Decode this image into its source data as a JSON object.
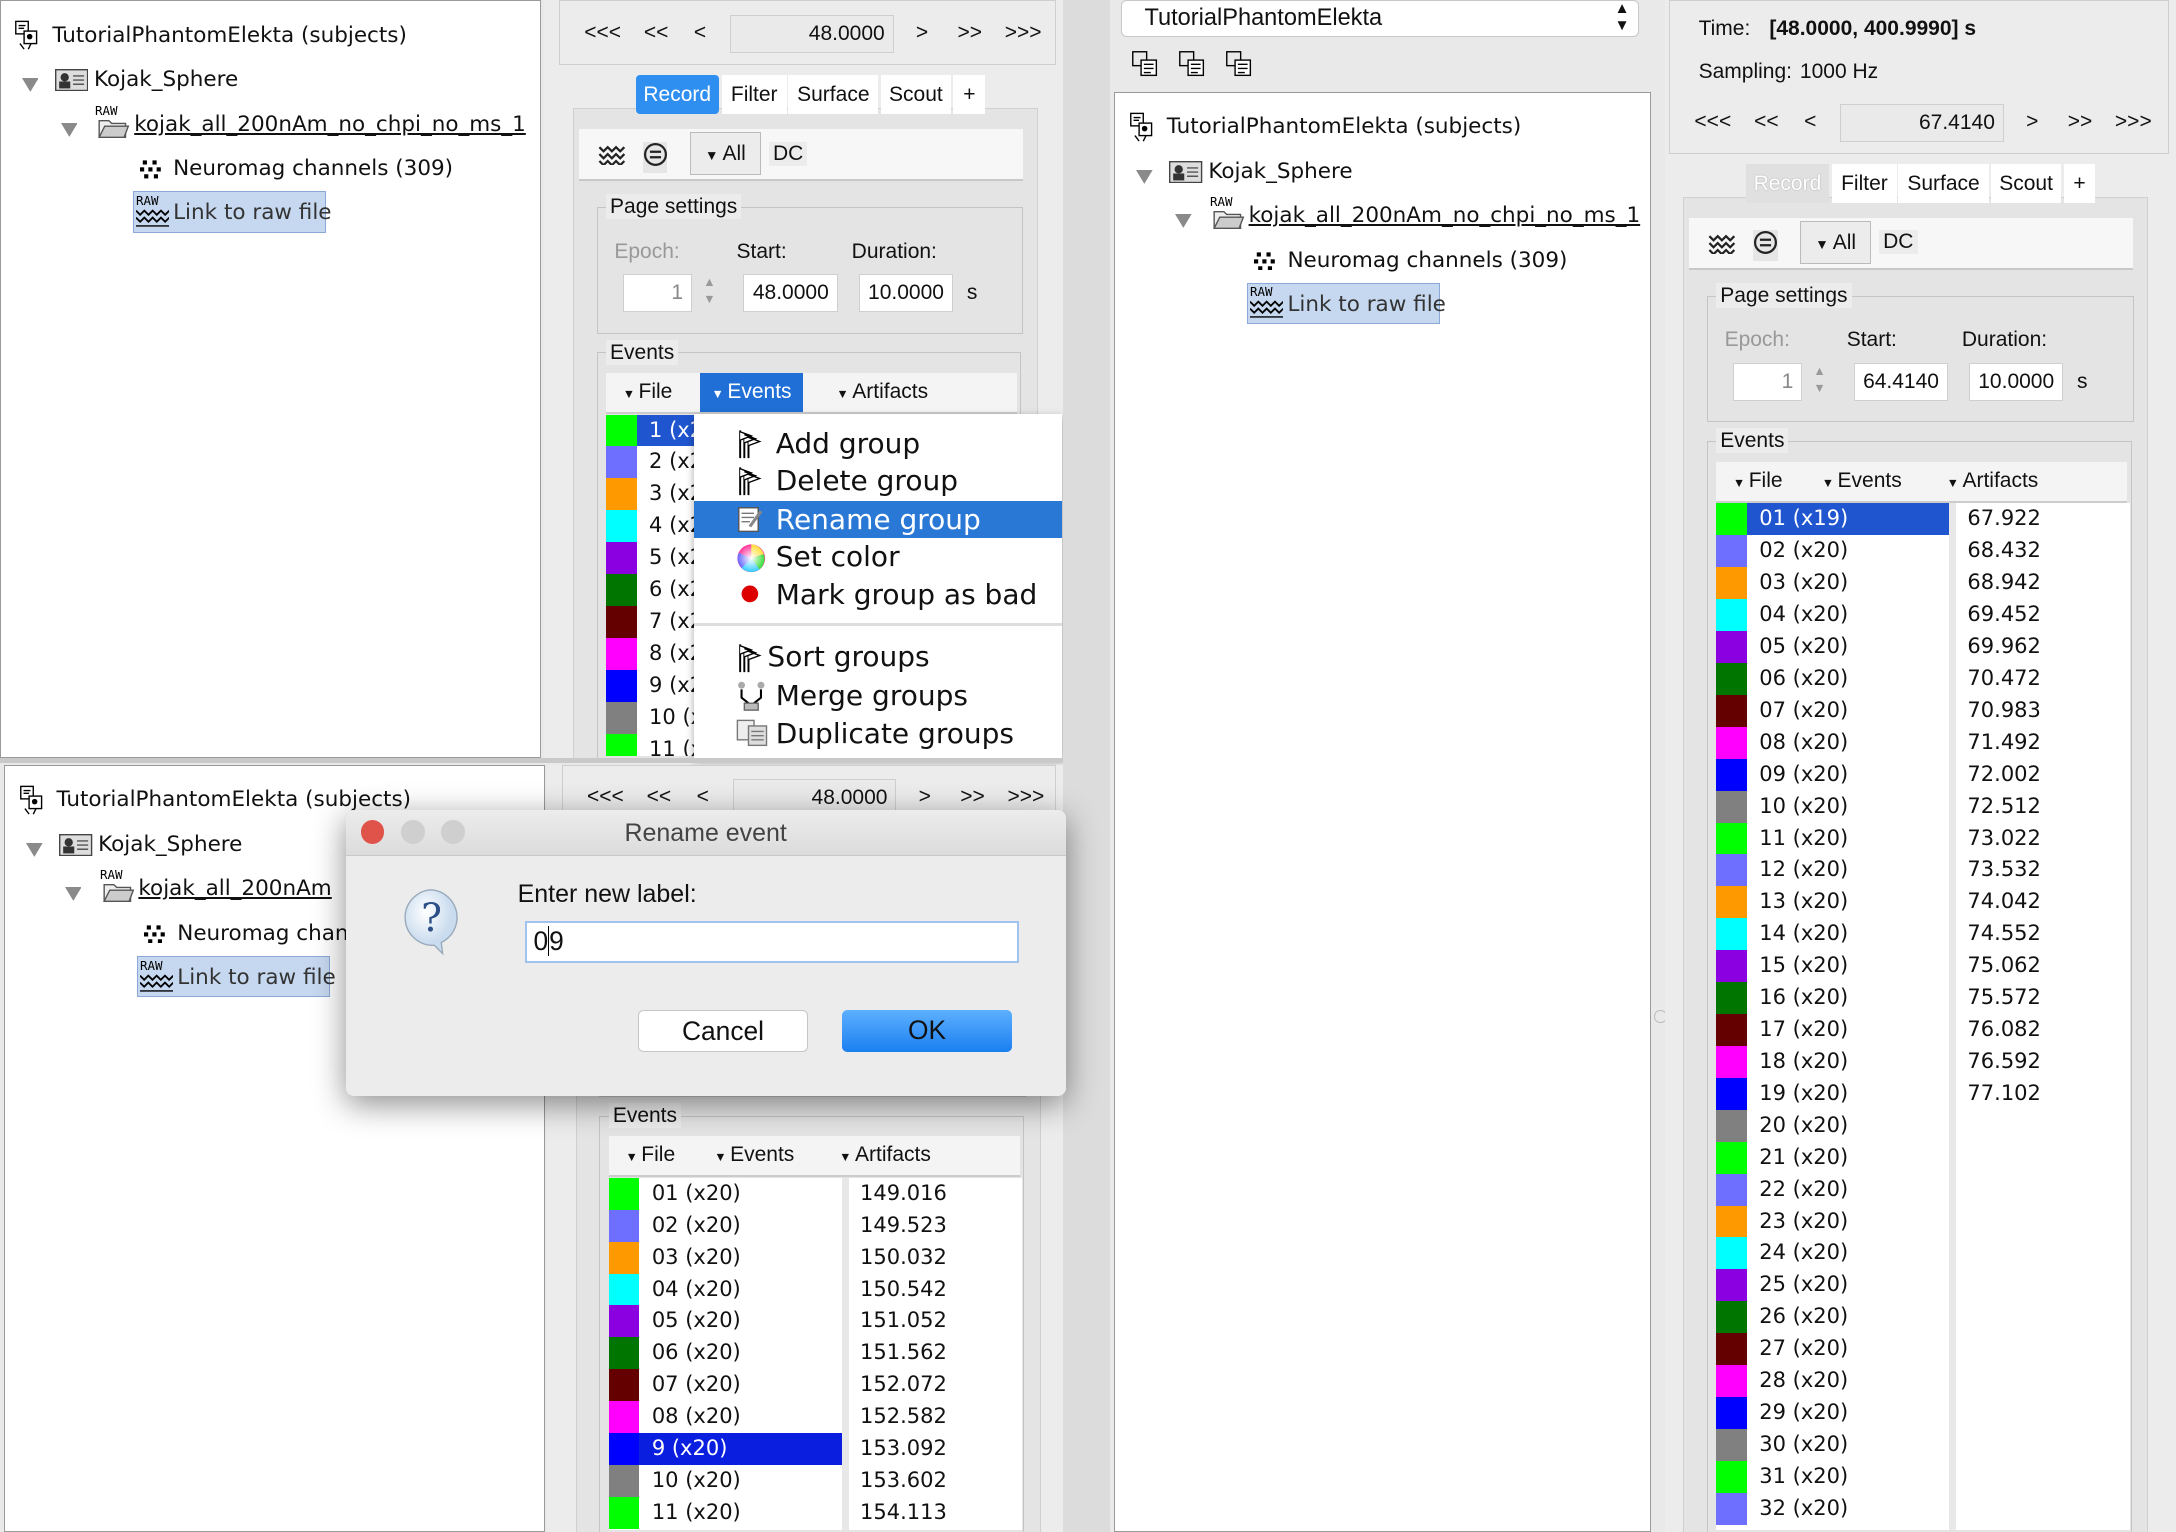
{
  "palette": [
    "#00ff00",
    "#6e6eff",
    "#ff9900",
    "#00ffff",
    "#8a00e0",
    "#007500",
    "#650000",
    "#ff00ff",
    "#0000ff",
    "#808080"
  ],
  "tree": {
    "root": "TutorialPhantomElekta (subjects)",
    "subject": "Kojak_Sphere",
    "file": "kojak_all_200nAm_no_chpi_no_ms_1",
    "file_short": "kojak_all_200nAm",
    "raw_badge": "RAW",
    "channels": "Neuromag channels (309)",
    "channels_short": "Neuromag chan",
    "link": "Link to raw file"
  },
  "nav": {
    "first": "<<<",
    "prev_big": "<<",
    "prev": "<",
    "next": ">",
    "next_big": ">>",
    "last": ">>>"
  },
  "tabs": [
    "Record",
    "Filter",
    "Surface",
    "Scout",
    "+"
  ],
  "toolbar": {
    "all": "All",
    "dc": "DC"
  },
  "page_settings": {
    "title": "Page settings",
    "epoch_label": "Epoch:",
    "start_label": "Start:",
    "duration_label": "Duration:",
    "unit": "s"
  },
  "events_box": {
    "title": "Events",
    "menus": [
      "File",
      "Events",
      "Artifacts"
    ]
  },
  "top_left": {
    "time": "48.0000",
    "epoch": "1",
    "start": "48.0000",
    "duration": "10.0000",
    "active_menu": 1,
    "selected": 0,
    "events": [
      "1 (x20)",
      "2 (x20)",
      "3 (x20)",
      "4 (x20)",
      "5 (x20)",
      "6 (x20)",
      "7 (x20)",
      "8 (x20)",
      "9 (x20)",
      "10 (x20)",
      "11 (x20)"
    ],
    "times": []
  },
  "context_menu": {
    "items": [
      {
        "label": "Add group",
        "icon": "add-group-icon"
      },
      {
        "label": "Delete group",
        "icon": "delete-group-icon"
      },
      {
        "label": "Rename group",
        "icon": "rename-icon",
        "highlighted": true
      },
      {
        "label": "Set color",
        "icon": "color-wheel-icon"
      },
      {
        "label": "Mark group as bad",
        "icon": "red-dot-icon"
      },
      {
        "label": "Sort groups",
        "icon": "sort-groups-icon"
      },
      {
        "label": "Merge groups",
        "icon": "merge-groups-icon"
      },
      {
        "label": "Duplicate groups",
        "icon": "duplicate-groups-icon"
      }
    ]
  },
  "bottom_left": {
    "time": "48.0000",
    "epoch": "1",
    "start": "48.0000",
    "duration": "10.0000",
    "active_menu": -1,
    "selected": 8,
    "events": [
      "01 (x20)",
      "02 (x20)",
      "03 (x20)",
      "04 (x20)",
      "05 (x20)",
      "06 (x20)",
      "07 (x20)",
      "08 (x20)",
      "9 (x20)",
      "10 (x20)",
      "11 (x20)"
    ],
    "times": [
      "149.016",
      "149.523",
      "150.032",
      "150.542",
      "151.052",
      "151.562",
      "152.072",
      "152.582",
      "153.092",
      "153.602",
      "154.113"
    ]
  },
  "dialog": {
    "title": "Rename event",
    "prompt": "Enter new label:",
    "value": "09",
    "cancel": "Cancel",
    "ok": "OK"
  },
  "right": {
    "combo": "TutorialPhantomElekta",
    "time_label": "Time:",
    "time_range": "[48.0000, 400.9990] s",
    "sampling_label": "Sampling:",
    "sampling": "1000 Hz",
    "time": "67.4140",
    "epoch": "1",
    "start": "64.4140",
    "duration": "10.0000",
    "active_menu": -1,
    "selected": 0,
    "events": [
      "01 (x19)",
      "02 (x20)",
      "03 (x20)",
      "04 (x20)",
      "05 (x20)",
      "06 (x20)",
      "07 (x20)",
      "08 (x20)",
      "09 (x20)",
      "10 (x20)",
      "11 (x20)",
      "12 (x20)",
      "13 (x20)",
      "14 (x20)",
      "15 (x20)",
      "16 (x20)",
      "17 (x20)",
      "18 (x20)",
      "19 (x20)",
      "20 (x20)",
      "21 (x20)",
      "22 (x20)",
      "23 (x20)",
      "24 (x20)",
      "25 (x20)",
      "26 (x20)",
      "27 (x20)",
      "28 (x20)",
      "29 (x20)",
      "30 (x20)",
      "31 (x20)",
      "32 (x20)"
    ],
    "times": [
      "67.922",
      "68.432",
      "68.942",
      "69.452",
      "69.962",
      "70.472",
      "70.983",
      "71.492",
      "72.002",
      "72.512",
      "73.022",
      "73.532",
      "74.042",
      "74.552",
      "75.062",
      "75.572",
      "76.082",
      "76.592",
      "77.102"
    ]
  }
}
